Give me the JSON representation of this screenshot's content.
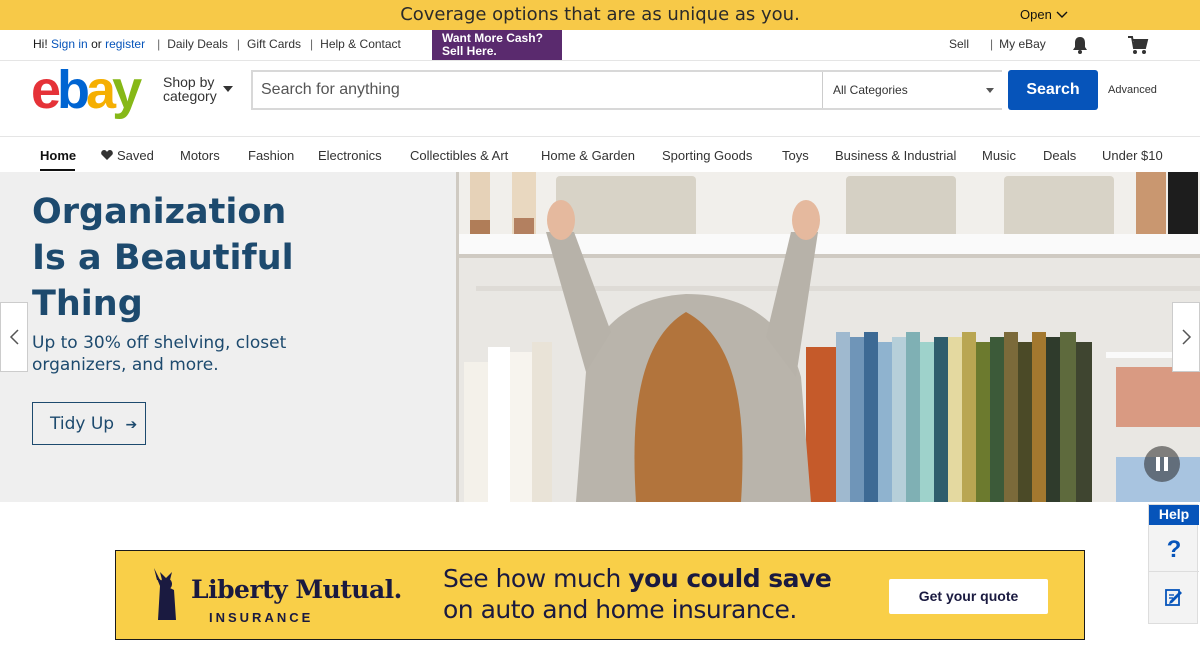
{
  "promo_top": {
    "text": "Coverage options that are as unique as you.",
    "open_label": "Open"
  },
  "util_bar": {
    "greeting": "Hi!",
    "sign_in": "Sign in",
    "or": "or",
    "register": "register",
    "daily_deals": "Daily Deals",
    "gift_cards": "Gift Cards",
    "help_contact": "Help & Contact",
    "sell_ad_line1": "Want More Cash?",
    "sell_ad_line2": "Sell Here.",
    "sell": "Sell",
    "my_ebay": "My eBay"
  },
  "header": {
    "logo": {
      "e": "e",
      "b": "b",
      "a": "a",
      "y": "y"
    },
    "shop_by_line1": "Shop by",
    "shop_by_line2": "category",
    "search_placeholder": "Search for anything",
    "category_selected": "All Categories",
    "search_button": "Search",
    "advanced": "Advanced"
  },
  "category_nav": [
    {
      "label": "Home"
    },
    {
      "label": "Saved"
    },
    {
      "label": "Motors"
    },
    {
      "label": "Fashion"
    },
    {
      "label": "Electronics"
    },
    {
      "label": "Collectibles & Art"
    },
    {
      "label": "Home & Garden"
    },
    {
      "label": "Sporting Goods"
    },
    {
      "label": "Toys"
    },
    {
      "label": "Business & Industrial"
    },
    {
      "label": "Music"
    },
    {
      "label": "Deals"
    },
    {
      "label": "Under $10"
    }
  ],
  "hero": {
    "title": "Organization Is a Beautiful Thing",
    "subtitle": "Up to 30% off shelving, closet organizers, and more.",
    "cta": "Tidy Up",
    "cta_arrow": "➔"
  },
  "ad": {
    "brand": "Liberty Mutual.",
    "brand_sub": "INSURANCE",
    "copy_line1_a": "See how much ",
    "copy_line1_b": "you could save",
    "copy_line2": "on auto and home insurance.",
    "button": "Get your quote"
  },
  "help_widget": {
    "title": "Help",
    "question": "?"
  },
  "colors": {
    "promo_bg": "#f7c948",
    "ebay_blue": "#0654ba",
    "hero_text": "#1d4a6e",
    "ad_bg": "#f9cf48",
    "logo_e": "#e53238",
    "logo_b": "#0064d2",
    "logo_a": "#f5af02",
    "logo_y": "#86b817"
  }
}
